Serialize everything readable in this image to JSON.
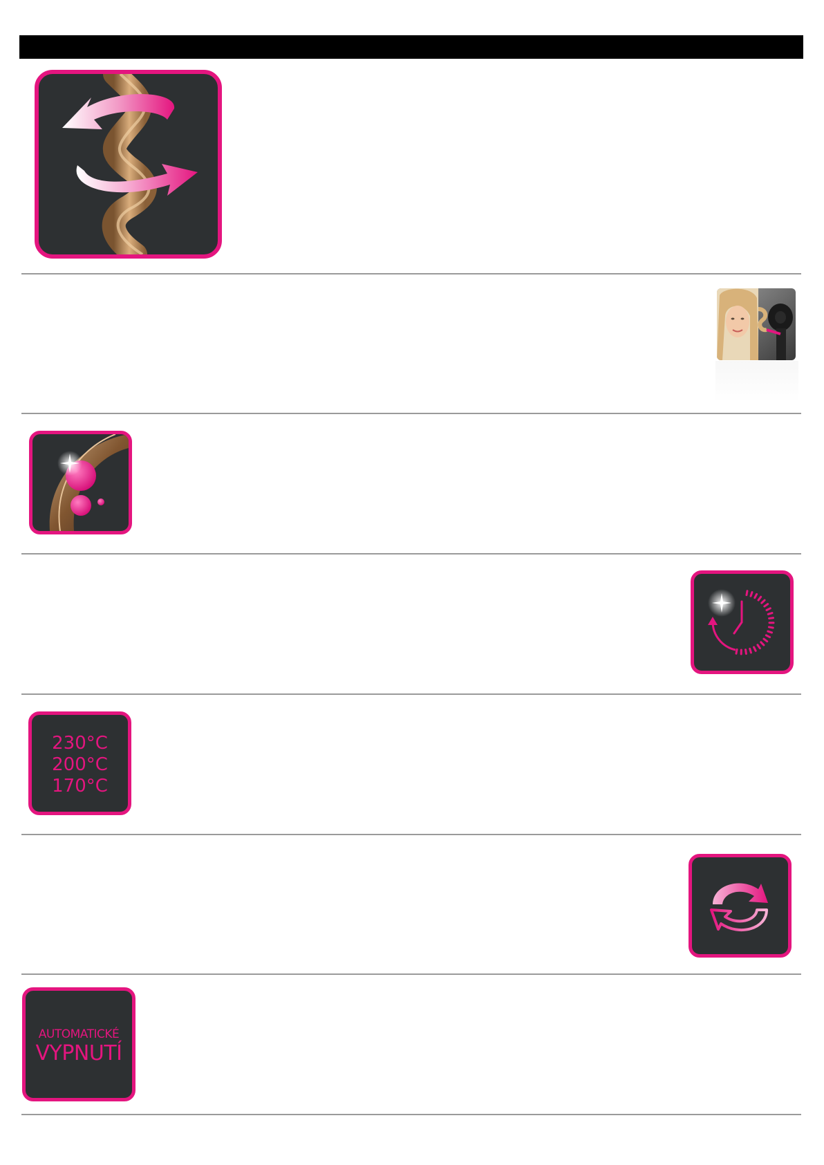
{
  "sections": [
    {
      "icon": "curl-rotation-icon"
    },
    {
      "icon": "woman-using-curler-photo"
    },
    {
      "icon": "ceramic-shine-icon"
    },
    {
      "icon": "quick-heat-timer-icon"
    },
    {
      "icon": "temperature-settings-icon",
      "temperatures": [
        "230°C",
        "200°C",
        "170°C"
      ]
    },
    {
      "icon": "direction-switch-icon"
    },
    {
      "icon": "auto-off-icon",
      "auto_off": {
        "line1": "AUTOMATICKÉ",
        "line2": "VYPNUTÍ"
      }
    }
  ],
  "colors": {
    "accent": "#e4157f",
    "tile_background": "#2d3032",
    "header_bar": "#000000",
    "divider": "#9a9a9a"
  }
}
